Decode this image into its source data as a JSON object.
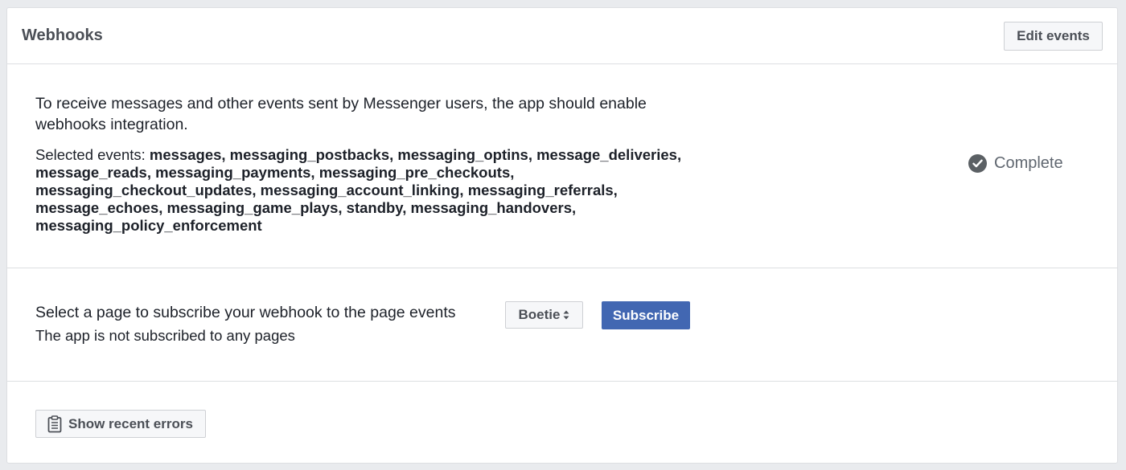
{
  "header": {
    "title": "Webhooks",
    "edit_label": "Edit events"
  },
  "webhooks": {
    "intro": "To receive messages and other events sent by Messenger users, the app should enable webhooks integration.",
    "events_prefix": "Selected events: ",
    "events_list": "messages, messaging_postbacks, messaging_optins, message_deliveries, message_reads, messaging_payments, messaging_pre_checkouts, messaging_checkout_updates, messaging_account_linking, messaging_referrals, message_echoes, messaging_game_plays, standby, messaging_handovers, messaging_policy_enforcement",
    "status": "Complete",
    "status_icon": "check-circle-icon"
  },
  "subscription": {
    "prompt": "Select a page to subscribe your webhook to the page events",
    "status": "The app is not subscribed to any pages",
    "selected_page": "Boetie",
    "subscribe_label": "Subscribe"
  },
  "errors": {
    "button_label": "Show recent errors",
    "icon": "clipboard-icon"
  },
  "colors": {
    "primary": "#4267b2",
    "border": "#dddfe2",
    "status_icon": "#5b6064"
  }
}
